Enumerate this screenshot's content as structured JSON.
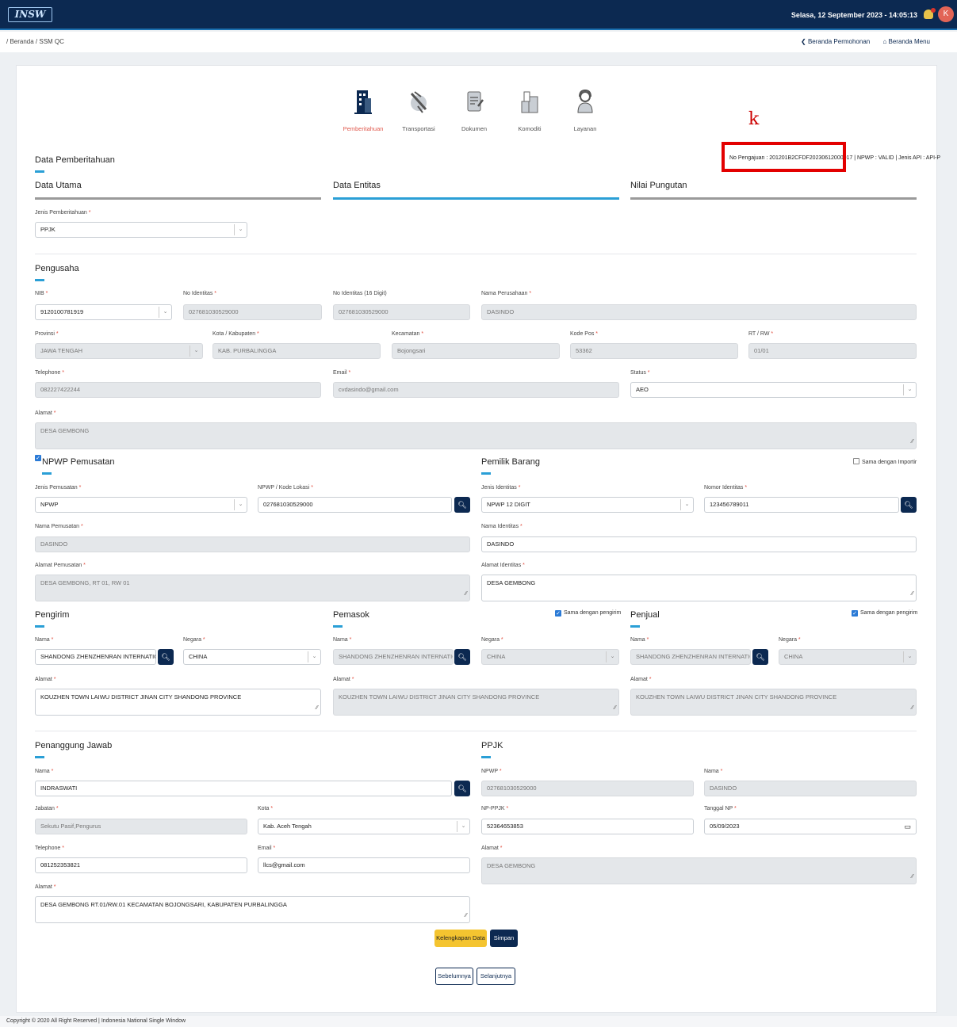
{
  "topbar": {
    "logo_text": "INSW",
    "datetime": "Selasa, 12 September 2023 - 14:05:13",
    "avatar_initial": "K"
  },
  "breadcrumb": "/ Beranda / SSM QC",
  "nav": {
    "back": "❮ Beranda Permohonan",
    "home": "⌂ Beranda Menu"
  },
  "steps": [
    "Pemberitahuan",
    "Transportasi",
    "Dokumen",
    "Komoditi",
    "Layanan"
  ],
  "annotation_letter": "k",
  "no_pengajuan": "No Pengajuan : 201201B2CFDF20230612000017 | NPWP : VALID | Jenis API : API-P",
  "data_pemberitahuan_title": "Data Pemberitahuan",
  "tabs": [
    "Data Utama",
    "Data Entitas",
    "Nilai Pungutan"
  ],
  "jenis_pemberitahuan": {
    "label": "Jenis Pemberitahuan",
    "value": "PPJK"
  },
  "pengusaha": {
    "title": "Pengusaha",
    "nib": {
      "label": "NIB",
      "value": "9120100781919"
    },
    "no_identitas": {
      "label": "No Identitas",
      "value": "027681030529000"
    },
    "no_identitas16": {
      "label": "No Identitas (16 Digit)",
      "value": "027681030529000"
    },
    "nama_perusahaan": {
      "label": "Nama Perusahaan",
      "value": "DASINDO"
    },
    "provinsi": {
      "label": "Provinsi",
      "value": "JAWA TENGAH"
    },
    "kota": {
      "label": "Kota / Kabupaten",
      "value": "KAB. PURBALINGGA"
    },
    "kecamatan": {
      "label": "Kecamatan",
      "value": "Bojongsari"
    },
    "kodepos": {
      "label": "Kode Pos",
      "value": "53362"
    },
    "rtrw": {
      "label": "RT / RW",
      "value": "01/01"
    },
    "telephone": {
      "label": "Telephone",
      "value": "082227422244"
    },
    "email": {
      "label": "Email",
      "value": "cvdasindo@gmail.com"
    },
    "status": {
      "label": "Status",
      "value": "AEO"
    },
    "alamat": {
      "label": "Alamat",
      "value": "DESA GEMBONG"
    }
  },
  "npwp": {
    "title": "NPWP Pemusatan",
    "jenis": {
      "label": "Jenis Pemusatan",
      "value": "NPWP"
    },
    "kode": {
      "label": "NPWP / Kode Lokasi",
      "value": "027681030529000"
    },
    "nama": {
      "label": "Nama Pemusatan",
      "value": "DASINDO"
    },
    "alamat": {
      "label": "Alamat Pemusatan",
      "value": "DESA GEMBONG, RT 01, RW 01"
    }
  },
  "pemilik": {
    "title": "Pemilik Barang",
    "sama": "Sama dengan Importir",
    "jenis": {
      "label": "Jenis Identitas",
      "value": "NPWP 12 DIGIT"
    },
    "nomor": {
      "label": "Nomor Identitas",
      "value": "123456789011"
    },
    "nama": {
      "label": "Nama Identitas",
      "value": "DASINDO"
    },
    "alamat": {
      "label": "Alamat Identitas",
      "value": "DESA GEMBONG"
    }
  },
  "pengirim": {
    "title": "Pengirim",
    "nama": {
      "label": "Nama",
      "value": "SHANDONG ZHENZHENRAN INTERNATIONAL TRA"
    },
    "negara": {
      "label": "Negara",
      "value": "CHINA"
    },
    "alamat": {
      "label": "Alamat",
      "value": "KOUZHEN TOWN LAIWU DISTRICT JINAN CITY SHANDONG PROVINCE"
    }
  },
  "pemasok": {
    "title": "Pemasok",
    "sama": "Sama dengan pengirim",
    "nama": {
      "label": "Nama",
      "value": "SHANDONG ZHENZHENRAN INTERNATIONAL TRA"
    },
    "negara": {
      "label": "Negara",
      "value": "CHINA"
    },
    "alamat": {
      "label": "Alamat",
      "value": "KOUZHEN TOWN LAIWU DISTRICT JINAN CITY SHANDONG PROVINCE"
    }
  },
  "penjual": {
    "title": "Penjual",
    "sama": "Sama dengan pengirim",
    "nama": {
      "label": "Nama",
      "value": "SHANDONG ZHENZHENRAN INTERNATIONAL TRA"
    },
    "negara": {
      "label": "Negara",
      "value": "CHINA"
    },
    "alamat": {
      "label": "Alamat",
      "value": "KOUZHEN TOWN LAIWU DISTRICT JINAN CITY SHANDONG PROVINCE"
    }
  },
  "penanggung": {
    "title": "Penanggung Jawab",
    "nama": {
      "label": "Nama",
      "value": "INDRASWATI"
    },
    "jabatan": {
      "label": "Jabatan",
      "value": "Sekutu Pasif,Pengurus"
    },
    "kota": {
      "label": "Kota",
      "value": "Kab. Aceh Tengah"
    },
    "telephone": {
      "label": "Telephone",
      "value": "081252353821"
    },
    "email": {
      "label": "Email",
      "value": "llcs@gmail.com"
    },
    "alamat": {
      "label": "Alamat",
      "value": "DESA GEMBONG RT.01/RW.01 KECAMATAN BOJONGSARI, KABUPATEN PURBALINGGA"
    }
  },
  "ppjk": {
    "title": "PPJK",
    "npwp": {
      "label": "NPWP",
      "value": "027681030529000"
    },
    "nama": {
      "label": "Nama",
      "value": "DASINDO"
    },
    "np": {
      "label": "NP-PPJK",
      "value": "52364653853"
    },
    "tanggal": {
      "label": "Tanggal NP",
      "value": "05/09/2023"
    },
    "alamat": {
      "label": "Alamat",
      "value": "DESA GEMBONG"
    }
  },
  "buttons": {
    "kelengkapan": "Kelengkapan Data",
    "simpan": "Simpan",
    "sebelumnya": "Sebelumnya",
    "selanjutnya": "Selanjutnya"
  },
  "footer": "Copyright © 2020 All Right Reserved | Indonesia National Single Window"
}
